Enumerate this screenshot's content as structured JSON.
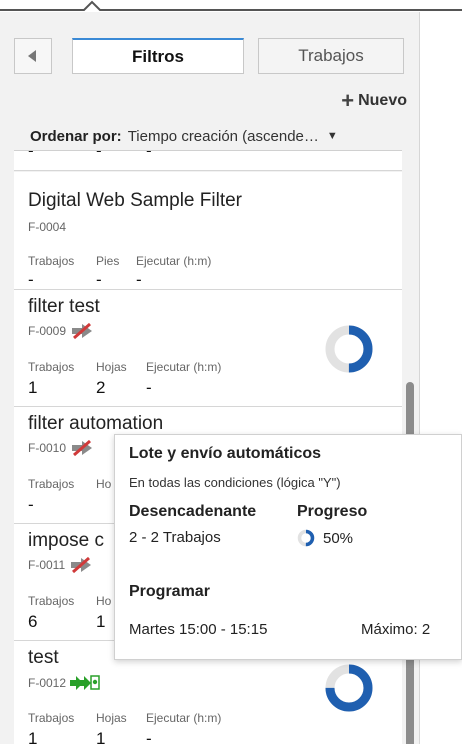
{
  "tabs": {
    "filters": "Filtros",
    "jobs": "Trabajos"
  },
  "toolbar": {
    "new_label": "Nuevo"
  },
  "sort": {
    "label": "Ordenar por:",
    "value": "Tiempo creación (ascende…"
  },
  "filters": [
    {
      "name": "",
      "id": "",
      "labels": [
        "",
        "",
        ""
      ],
      "values": [
        "-",
        "-",
        "-"
      ]
    },
    {
      "name": "Digital Web Sample Filter",
      "id": "F-0004",
      "labels": [
        "Trabajos",
        "Pies",
        "Ejecutar (h:m)"
      ],
      "values": [
        "-",
        "-",
        "-"
      ]
    },
    {
      "name": "filter test",
      "id": "F-0009",
      "labels": [
        "Trabajos",
        "Hojas",
        "Ejecutar (h:m)"
      ],
      "values": [
        "1",
        "2",
        "-"
      ],
      "progress": 0.5
    },
    {
      "name": "filter automation",
      "id": "F-0010",
      "labels": [
        "Trabajos",
        "Ho",
        ""
      ],
      "values": [
        "-",
        "",
        ""
      ]
    },
    {
      "name": "impose c",
      "id": "F-0011",
      "labels": [
        "Trabajos",
        "Ho",
        ""
      ],
      "values": [
        "6",
        "1",
        ""
      ]
    },
    {
      "name": "test",
      "id": "F-0012",
      "labels": [
        "Trabajos",
        "Hojas",
        "Ejecutar (h:m)"
      ],
      "values": [
        "1",
        "1",
        "-"
      ],
      "progress": 0.75
    }
  ],
  "popup": {
    "title": "Lote y envío automáticos",
    "subtitle": "En todas las condiciones (lógica \"Y\")",
    "trigger_label": "Desencadenante",
    "trigger_value": "2 - 2 Trabajos",
    "progress_label": "Progreso",
    "progress_value": "50%",
    "progress_fraction": 0.5,
    "schedule_label": "Programar",
    "schedule_value": "Martes 15:00 - 15:15",
    "max_value": "Máximo: 2"
  },
  "colors": {
    "accent": "#1f5fb0",
    "donut_track": "#e2e2e2",
    "tab_active_border": "#3a8ad6",
    "disabled_red": "#d03a3a",
    "enabled_green": "#2aa02a"
  }
}
